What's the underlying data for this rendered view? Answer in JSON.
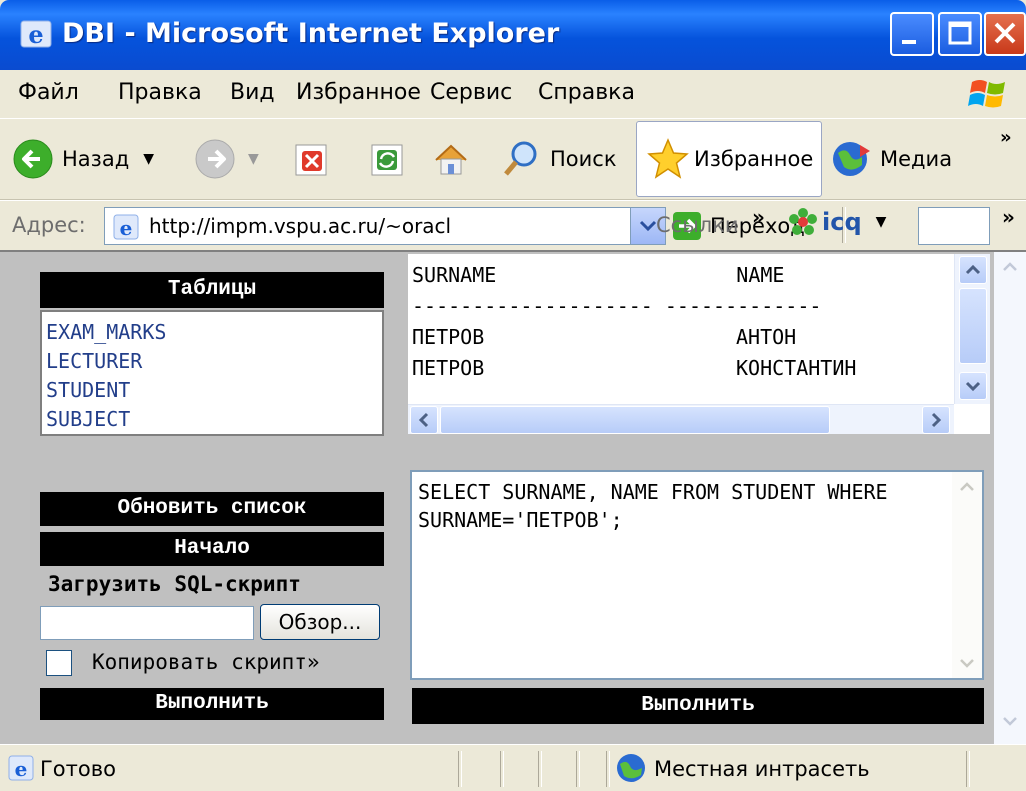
{
  "window": {
    "title": "DBI - Microsoft Internet Explorer",
    "accent": "#0a5ee8"
  },
  "menu": [
    "Файл",
    "Правка",
    "Вид",
    "Избранное",
    "Сервис",
    "Справка"
  ],
  "toolbar": {
    "back": "Назад",
    "search": "Поиск",
    "favorites": "Избранное",
    "media": "Медиа"
  },
  "address": {
    "label": "Адрес:",
    "url": "http://impm.vspu.ac.ru/~oracl",
    "go": "Переход",
    "links": "Ссылки",
    "icq": "icq"
  },
  "left_panel": {
    "tables_header": "Таблицы",
    "tables": [
      "EXAM_MARKS",
      "LECTURER",
      "STUDENT",
      "SUBJECT"
    ],
    "refresh_button": "Обновить список",
    "home_button": "Начало",
    "load_label": "Загрузить SQL-скрипт",
    "browse_button": "Обзор...",
    "copy_label": "Копировать скрипт»",
    "execute_button": "Выполнить"
  },
  "result": {
    "columns": [
      "SURNAME",
      "NAME"
    ],
    "separator_1": "--------------------",
    "separator_2": "-------------",
    "rows": [
      [
        "ПЕТРОВ",
        "АНТОН"
      ],
      [
        "ПЕТРОВ",
        "КОНСТАНТИН"
      ]
    ]
  },
  "sql": {
    "query": "SELECT SURNAME, NAME FROM STUDENT WHERE SURNAME='ПЕТРОВ';",
    "execute_button": "Выполнить"
  },
  "status": {
    "text": "Готово",
    "zone": "Местная интрасеть"
  }
}
